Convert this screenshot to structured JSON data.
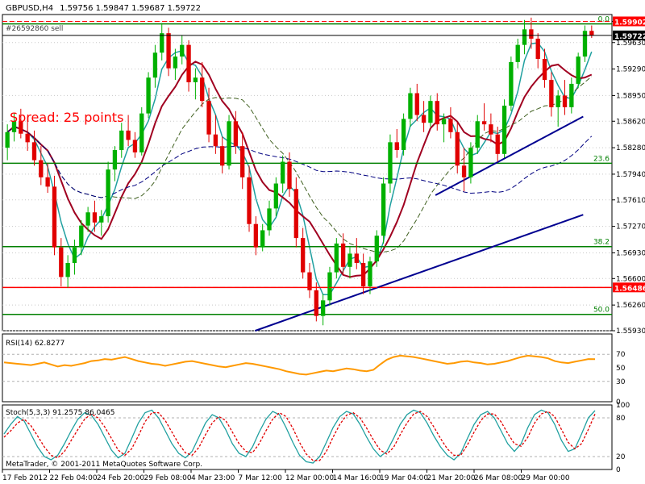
{
  "header": {
    "symbol": "GBPUSD,H4",
    "ohlc": "1.59756 1.59847 1.59687 1.59722"
  },
  "spread_text": "Spread: 25 points",
  "trade_label": "#26592860 sell",
  "copyright": "MetaTrader, © 2001-2011 MetaQuotes Software Corp.",
  "colors": {
    "background": "#ffffff",
    "bull_candle": "#00b000",
    "bear_candle": "#e00000",
    "ma_teal": "#20a0a0",
    "ma_darkred": "#a00020",
    "ma_olive": "#406020",
    "ma_navy": "#000080",
    "trendline": "#000090",
    "fib_line": "#008000",
    "support_line": "#ff0000",
    "rsi_line": "#ff9900",
    "stoch_main": "#20a0a0",
    "stoch_signal": "#e00000",
    "price_tag_red": "#ff0000",
    "price_tag_black": "#000000"
  },
  "chart_data": [
    {
      "type": "candlestick",
      "title": "GBPUSD,H4",
      "ylim": [
        1.5593,
        1.5999
      ],
      "y_ticks": [
        "1.59902",
        "1.59630",
        "1.59290",
        "1.58950",
        "1.58620",
        "1.58280",
        "1.57940",
        "1.57610",
        "1.57270",
        "1.56930",
        "1.56600",
        "1.56260",
        "1.55930"
      ],
      "x_ticks": [
        "17 Feb 2012",
        "22 Feb 04:00",
        "24 Feb 20:00",
        "29 Feb 08:00",
        "4 Mar 23:00",
        "7 Mar 12:00",
        "12 Mar 00:00",
        "14 Mar 16:00",
        "19 Mar 04:00",
        "21 Mar 20:00",
        "26 Mar 08:00",
        "29 Mar 00:00"
      ],
      "price_tags": [
        {
          "text": "1.59902",
          "value": 1.59902,
          "style": "red"
        },
        {
          "text": "1.59722",
          "value": 1.59722,
          "style": "black"
        },
        {
          "text": "1.56486",
          "value": 1.56486,
          "style": "red"
        }
      ],
      "fib_levels": [
        {
          "label": "0.0",
          "value": 1.5987
        },
        {
          "label": "23.6",
          "value": 1.5808
        },
        {
          "label": "38.2",
          "value": 1.5701
        },
        {
          "label": "50.0",
          "value": 1.5614
        }
      ],
      "support_level": 1.56486,
      "trendlines": [
        {
          "from": [
            0.425,
            1.5593
          ],
          "to": [
            0.98,
            1.5742
          ]
        },
        {
          "from": [
            0.73,
            1.5767
          ],
          "to": [
            0.98,
            1.5868
          ]
        }
      ],
      "candles": [
        {
          "o": 1.5828,
          "h": 1.5858,
          "l": 1.5812,
          "c": 1.5848
        },
        {
          "o": 1.5848,
          "h": 1.5872,
          "l": 1.5836,
          "c": 1.5862
        },
        {
          "o": 1.5862,
          "h": 1.5878,
          "l": 1.584,
          "c": 1.5846
        },
        {
          "o": 1.5846,
          "h": 1.5868,
          "l": 1.5824,
          "c": 1.5835
        },
        {
          "o": 1.5835,
          "h": 1.585,
          "l": 1.5805,
          "c": 1.5812
        },
        {
          "o": 1.5812,
          "h": 1.583,
          "l": 1.578,
          "c": 1.579
        },
        {
          "o": 1.579,
          "h": 1.5808,
          "l": 1.577,
          "c": 1.5778
        },
        {
          "o": 1.5778,
          "h": 1.5792,
          "l": 1.569,
          "c": 1.57
        },
        {
          "o": 1.57,
          "h": 1.5712,
          "l": 1.565,
          "c": 1.5662
        },
        {
          "o": 1.5662,
          "h": 1.569,
          "l": 1.5648,
          "c": 1.568
        },
        {
          "o": 1.568,
          "h": 1.571,
          "l": 1.5665,
          "c": 1.57
        },
        {
          "o": 1.57,
          "h": 1.5735,
          "l": 1.569,
          "c": 1.5728
        },
        {
          "o": 1.5728,
          "h": 1.5752,
          "l": 1.572,
          "c": 1.5745
        },
        {
          "o": 1.5745,
          "h": 1.576,
          "l": 1.572,
          "c": 1.5732
        },
        {
          "o": 1.5732,
          "h": 1.5748,
          "l": 1.5715,
          "c": 1.574
        },
        {
          "o": 1.574,
          "h": 1.581,
          "l": 1.5732,
          "c": 1.58
        },
        {
          "o": 1.58,
          "h": 1.583,
          "l": 1.5785,
          "c": 1.5825
        },
        {
          "o": 1.5825,
          "h": 1.586,
          "l": 1.5815,
          "c": 1.585
        },
        {
          "o": 1.585,
          "h": 1.587,
          "l": 1.583,
          "c": 1.5838
        },
        {
          "o": 1.5838,
          "h": 1.5848,
          "l": 1.5815,
          "c": 1.5822
        },
        {
          "o": 1.5822,
          "h": 1.588,
          "l": 1.5818,
          "c": 1.5872
        },
        {
          "o": 1.5872,
          "h": 1.5925,
          "l": 1.5866,
          "c": 1.5918
        },
        {
          "o": 1.5918,
          "h": 1.596,
          "l": 1.5905,
          "c": 1.595
        },
        {
          "o": 1.595,
          "h": 1.5988,
          "l": 1.594,
          "c": 1.5975
        },
        {
          "o": 1.5975,
          "h": 1.5982,
          "l": 1.592,
          "c": 1.593
        },
        {
          "o": 1.593,
          "h": 1.5955,
          "l": 1.5915,
          "c": 1.5945
        },
        {
          "o": 1.5945,
          "h": 1.5972,
          "l": 1.5935,
          "c": 1.596
        },
        {
          "o": 1.596,
          "h": 1.5966,
          "l": 1.59,
          "c": 1.5912
        },
        {
          "o": 1.5912,
          "h": 1.593,
          "l": 1.589,
          "c": 1.5918
        },
        {
          "o": 1.5918,
          "h": 1.5938,
          "l": 1.588,
          "c": 1.5888
        },
        {
          "o": 1.5888,
          "h": 1.5905,
          "l": 1.5835,
          "c": 1.5845
        },
        {
          "o": 1.5845,
          "h": 1.587,
          "l": 1.582,
          "c": 1.583
        },
        {
          "o": 1.583,
          "h": 1.5842,
          "l": 1.5795,
          "c": 1.5805
        },
        {
          "o": 1.5805,
          "h": 1.587,
          "l": 1.58,
          "c": 1.5862
        },
        {
          "o": 1.5862,
          "h": 1.5875,
          "l": 1.582,
          "c": 1.583
        },
        {
          "o": 1.583,
          "h": 1.5848,
          "l": 1.5775,
          "c": 1.579
        },
        {
          "o": 1.579,
          "h": 1.5805,
          "l": 1.572,
          "c": 1.573
        },
        {
          "o": 1.573,
          "h": 1.574,
          "l": 1.569,
          "c": 1.57
        },
        {
          "o": 1.57,
          "h": 1.573,
          "l": 1.5695,
          "c": 1.5722
        },
        {
          "o": 1.5722,
          "h": 1.576,
          "l": 1.5715,
          "c": 1.575
        },
        {
          "o": 1.575,
          "h": 1.579,
          "l": 1.574,
          "c": 1.5782
        },
        {
          "o": 1.5782,
          "h": 1.5818,
          "l": 1.577,
          "c": 1.581
        },
        {
          "o": 1.581,
          "h": 1.5822,
          "l": 1.5765,
          "c": 1.5775
        },
        {
          "o": 1.5775,
          "h": 1.579,
          "l": 1.57,
          "c": 1.5712
        },
        {
          "o": 1.5712,
          "h": 1.5725,
          "l": 1.566,
          "c": 1.5668
        },
        {
          "o": 1.5668,
          "h": 1.568,
          "l": 1.5635,
          "c": 1.5645
        },
        {
          "o": 1.5645,
          "h": 1.5655,
          "l": 1.5605,
          "c": 1.5612
        },
        {
          "o": 1.5612,
          "h": 1.564,
          "l": 1.56,
          "c": 1.5632
        },
        {
          "o": 1.5632,
          "h": 1.5675,
          "l": 1.5625,
          "c": 1.5668
        },
        {
          "o": 1.5668,
          "h": 1.5712,
          "l": 1.566,
          "c": 1.5705
        },
        {
          "o": 1.5705,
          "h": 1.5718,
          "l": 1.5665,
          "c": 1.5675
        },
        {
          "o": 1.5675,
          "h": 1.57,
          "l": 1.566,
          "c": 1.5692
        },
        {
          "o": 1.5692,
          "h": 1.5712,
          "l": 1.5672,
          "c": 1.568
        },
        {
          "o": 1.568,
          "h": 1.5692,
          "l": 1.564,
          "c": 1.565
        },
        {
          "o": 1.565,
          "h": 1.5688,
          "l": 1.564,
          "c": 1.5682
        },
        {
          "o": 1.5682,
          "h": 1.5722,
          "l": 1.5675,
          "c": 1.5715
        },
        {
          "o": 1.5715,
          "h": 1.579,
          "l": 1.5705,
          "c": 1.5782
        },
        {
          "o": 1.5782,
          "h": 1.5845,
          "l": 1.577,
          "c": 1.5835
        },
        {
          "o": 1.5835,
          "h": 1.5852,
          "l": 1.5815,
          "c": 1.5825
        },
        {
          "o": 1.5825,
          "h": 1.5872,
          "l": 1.5818,
          "c": 1.5865
        },
        {
          "o": 1.5865,
          "h": 1.5905,
          "l": 1.5855,
          "c": 1.5898
        },
        {
          "o": 1.5898,
          "h": 1.591,
          "l": 1.5862,
          "c": 1.587
        },
        {
          "o": 1.587,
          "h": 1.5888,
          "l": 1.5848,
          "c": 1.586
        },
        {
          "o": 1.586,
          "h": 1.5895,
          "l": 1.5855,
          "c": 1.5888
        },
        {
          "o": 1.5888,
          "h": 1.5898,
          "l": 1.585,
          "c": 1.5858
        },
        {
          "o": 1.5858,
          "h": 1.5872,
          "l": 1.5835,
          "c": 1.5865
        },
        {
          "o": 1.5865,
          "h": 1.588,
          "l": 1.584,
          "c": 1.5848
        },
        {
          "o": 1.5848,
          "h": 1.586,
          "l": 1.5795,
          "c": 1.5805
        },
        {
          "o": 1.5805,
          "h": 1.5828,
          "l": 1.5772,
          "c": 1.579
        },
        {
          "o": 1.579,
          "h": 1.5835,
          "l": 1.5782,
          "c": 1.5828
        },
        {
          "o": 1.5828,
          "h": 1.587,
          "l": 1.582,
          "c": 1.5862
        },
        {
          "o": 1.5862,
          "h": 1.5885,
          "l": 1.585,
          "c": 1.5858
        },
        {
          "o": 1.5858,
          "h": 1.5872,
          "l": 1.5835,
          "c": 1.5845
        },
        {
          "o": 1.5845,
          "h": 1.5855,
          "l": 1.581,
          "c": 1.582
        },
        {
          "o": 1.582,
          "h": 1.589,
          "l": 1.5815,
          "c": 1.5882
        },
        {
          "o": 1.5882,
          "h": 1.5945,
          "l": 1.5875,
          "c": 1.5938
        },
        {
          "o": 1.5938,
          "h": 1.5968,
          "l": 1.593,
          "c": 1.596
        },
        {
          "o": 1.596,
          "h": 1.5992,
          "l": 1.5948,
          "c": 1.598
        },
        {
          "o": 1.598,
          "h": 1.5995,
          "l": 1.5955,
          "c": 1.5968
        },
        {
          "o": 1.5968,
          "h": 1.5975,
          "l": 1.593,
          "c": 1.5942
        },
        {
          "o": 1.5942,
          "h": 1.5955,
          "l": 1.5905,
          "c": 1.5915
        },
        {
          "o": 1.5915,
          "h": 1.5925,
          "l": 1.5868,
          "c": 1.588
        },
        {
          "o": 1.588,
          "h": 1.5902,
          "l": 1.5855,
          "c": 1.5895
        },
        {
          "o": 1.5895,
          "h": 1.5915,
          "l": 1.587,
          "c": 1.588
        },
        {
          "o": 1.588,
          "h": 1.5918,
          "l": 1.5872,
          "c": 1.591
        },
        {
          "o": 1.591,
          "h": 1.595,
          "l": 1.5905,
          "c": 1.5945
        },
        {
          "o": 1.5945,
          "h": 1.5985,
          "l": 1.5938,
          "c": 1.5978
        },
        {
          "o": 1.5978,
          "h": 1.5985,
          "l": 1.5969,
          "c": 1.5972
        }
      ]
    },
    {
      "type": "line",
      "title": "RSI(14) 62.8277",
      "ylim": [
        0,
        100
      ],
      "y_ticks": [
        "70",
        "50",
        "30",
        "0"
      ],
      "levels": [
        70,
        30
      ],
      "series": [
        {
          "values": [
            58,
            57,
            56,
            55,
            54,
            56,
            58,
            55,
            52,
            54,
            53,
            55,
            57,
            60,
            61,
            63,
            62,
            64,
            66,
            63,
            60,
            58,
            56,
            55,
            53,
            55,
            57,
            59,
            60,
            58,
            56,
            54,
            52,
            51,
            53,
            55,
            57,
            56,
            54,
            52,
            50,
            48,
            45,
            43,
            41,
            40,
            42,
            44,
            46,
            45,
            47,
            49,
            48,
            46,
            45,
            47,
            55,
            62,
            66,
            68,
            67,
            66,
            64,
            62,
            60,
            58,
            56,
            57,
            59,
            60,
            58,
            57,
            55,
            56,
            58,
            60,
            63,
            66,
            68,
            67,
            66,
            64,
            60,
            58,
            57,
            59,
            61,
            63,
            62.8
          ]
        }
      ]
    },
    {
      "type": "line",
      "title": "Stoch(5,3,3) 91.2575 86.0465",
      "ylim": [
        0,
        100
      ],
      "y_ticks": [
        "100",
        "80",
        "20",
        "0"
      ],
      "levels": [
        80,
        20
      ],
      "series": [
        {
          "values": [
            55,
            70,
            82,
            75,
            55,
            35,
            20,
            15,
            22,
            40,
            60,
            78,
            88,
            84,
            70,
            50,
            30,
            18,
            25,
            48,
            72,
            88,
            92,
            80,
            60,
            40,
            25,
            18,
            28,
            50,
            72,
            85,
            80,
            62,
            40,
            25,
            20,
            35,
            58,
            78,
            90,
            85,
            65,
            42,
            22,
            12,
            10,
            20,
            42,
            65,
            82,
            90,
            86,
            70,
            50,
            32,
            20,
            28,
            48,
            70,
            85,
            92,
            88,
            72,
            52,
            35,
            22,
            15,
            25,
            48,
            70,
            85,
            90,
            80,
            60,
            40,
            28,
            40,
            65,
            85,
            92,
            88,
            70,
            45,
            28,
            32,
            55,
            80,
            91.3
          ]
        },
        {
          "values": [
            50,
            60,
            72,
            78,
            68,
            52,
            35,
            22,
            18,
            28,
            45,
            62,
            78,
            86,
            80,
            66,
            48,
            30,
            22,
            32,
            52,
            74,
            88,
            88,
            76,
            58,
            40,
            26,
            22,
            34,
            54,
            72,
            82,
            76,
            58,
            40,
            28,
            26,
            40,
            60,
            78,
            88,
            82,
            64,
            42,
            24,
            14,
            14,
            28,
            50,
            70,
            84,
            88,
            80,
            64,
            46,
            30,
            24,
            34,
            54,
            72,
            86,
            90,
            82,
            66,
            48,
            32,
            22,
            22,
            38,
            58,
            76,
            86,
            86,
            74,
            56,
            40,
            36,
            50,
            72,
            86,
            90,
            82,
            62,
            42,
            32,
            40,
            62,
            86
          ]
        }
      ]
    }
  ]
}
